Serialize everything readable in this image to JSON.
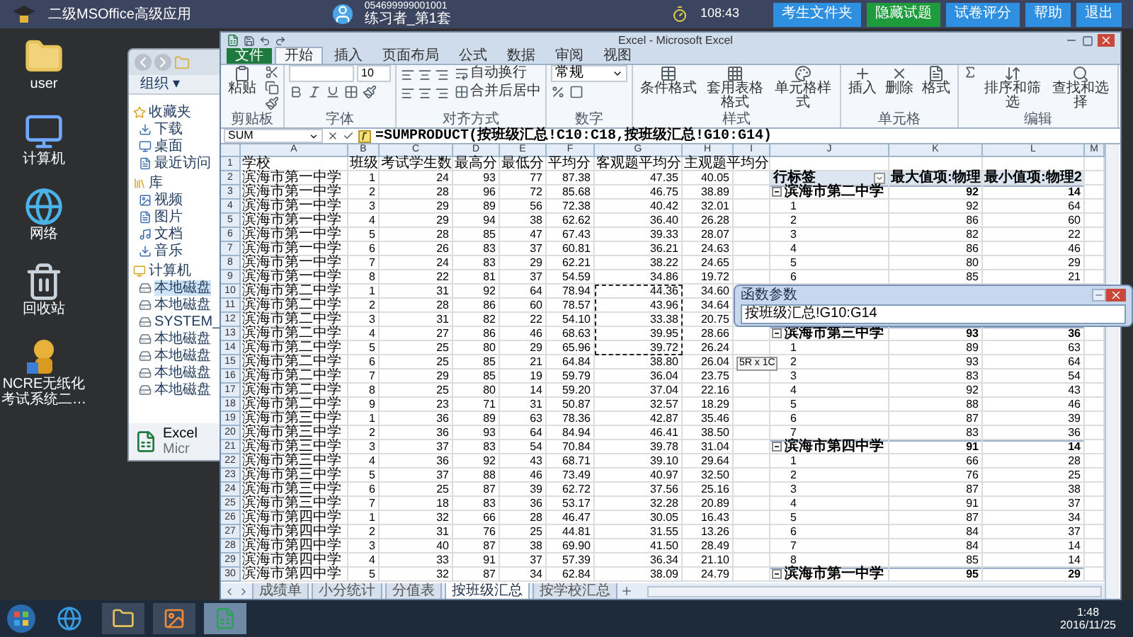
{
  "exam_bar": {
    "title": "二级MSOffice高级应用",
    "candidate_id": "054699999001001",
    "candidate_name": "练习者_第1套",
    "timer": "108:43",
    "buttons": [
      {
        "label": "考生文件夹",
        "color": "#2f8fe0"
      },
      {
        "label": "隐藏试题",
        "color": "#1e9b3c"
      },
      {
        "label": "试卷评分",
        "color": "#2f8fe0"
      },
      {
        "label": "帮助",
        "color": "#2f8fe0"
      },
      {
        "label": "退出",
        "color": "#2f8fe0"
      }
    ]
  },
  "desktop_icons": [
    {
      "kind": "folder",
      "label": "user"
    },
    {
      "kind": "computer",
      "label": "计算机"
    },
    {
      "kind": "network",
      "label": "网络"
    },
    {
      "kind": "trash",
      "label": "回收站"
    },
    {
      "kind": "app",
      "label": "NCRE无纸化考试系统二…"
    }
  ],
  "explorer": {
    "organize": "组织 ▾",
    "items": [
      {
        "kind": "section",
        "label": "收藏夹"
      },
      {
        "kind": "item",
        "label": "下载"
      },
      {
        "kind": "item",
        "label": "桌面"
      },
      {
        "kind": "item",
        "label": "最近访问"
      },
      {
        "kind": "section",
        "label": "库"
      },
      {
        "kind": "item",
        "label": "视频"
      },
      {
        "kind": "item",
        "label": "图片"
      },
      {
        "kind": "item",
        "label": "文档"
      },
      {
        "kind": "item",
        "label": "音乐"
      },
      {
        "kind": "section",
        "label": "计算机"
      },
      {
        "kind": "drive",
        "label": "本地磁盘",
        "selected": true
      },
      {
        "kind": "drive",
        "label": "本地磁盘",
        "selected": false
      },
      {
        "kind": "drive",
        "label": "SYSTEM_",
        "selected": false
      },
      {
        "kind": "drive",
        "label": "本地磁盘",
        "selected": false
      },
      {
        "kind": "drive",
        "label": "本地磁盘",
        "selected": false
      },
      {
        "kind": "drive",
        "label": "本地磁盘",
        "selected": false
      },
      {
        "kind": "drive",
        "label": "本地磁盘",
        "selected": false
      }
    ],
    "file": {
      "name": "Excel",
      "type": "Micr"
    }
  },
  "excel": {
    "title": "Excel - Microsoft Excel",
    "tabs": [
      {
        "label": "文件",
        "kind": "file",
        "selected": false
      },
      {
        "label": "开始",
        "kind": "tab",
        "selected": true
      },
      {
        "label": "插入",
        "kind": "tab",
        "selected": false
      },
      {
        "label": "页面布局",
        "kind": "tab",
        "selected": false
      },
      {
        "label": "公式",
        "kind": "tab",
        "selected": false
      },
      {
        "label": "数据",
        "kind": "tab",
        "selected": false
      },
      {
        "label": "审阅",
        "kind": "tab",
        "selected": false
      },
      {
        "label": "视图",
        "kind": "tab",
        "selected": false
      }
    ],
    "ribbon": [
      {
        "kind": "clipboard",
        "label": "剪贴板",
        "buttons": [
          "粘贴"
        ]
      },
      {
        "kind": "font",
        "label": "字体",
        "font_size": "10"
      },
      {
        "kind": "alignment",
        "label": "对齐方式",
        "buttons": [
          "自动换行",
          "合并后居中"
        ]
      },
      {
        "kind": "number",
        "label": "数字",
        "format": "常规"
      },
      {
        "kind": "styles",
        "label": "样式",
        "buttons": [
          "条件格式",
          "套用表格格式",
          "单元格样式"
        ]
      },
      {
        "kind": "cells",
        "label": "单元格",
        "buttons": [
          "插入",
          "删除",
          "格式"
        ]
      },
      {
        "kind": "editing",
        "label": "编辑",
        "buttons": [
          "排序和筛选",
          "查找和选择"
        ]
      }
    ],
    "name_box": "SUM",
    "formula": "=SUMPRODUCT(按班级汇总!C10:C18,按班级汇总!G10:G14)",
    "columns": [
      "A",
      "B",
      "C",
      "D",
      "E",
      "F",
      "G",
      "H",
      "I",
      "J",
      "K",
      "L",
      "M"
    ],
    "rows": [
      {
        "number": "1",
        "cells": [
          "学校",
          "班级",
          "考试学生数",
          "最高分",
          "最低分",
          "平均分",
          "客观题平均分",
          "主观题平均分"
        ]
      },
      {
        "number": "2",
        "cells": [
          "滨海市第一中学",
          "1",
          "24",
          "93",
          "77",
          "87.38",
          "47.35",
          "40.05"
        ],
        "pivot": {
          "kind": "header",
          "label": "行标签",
          "max": "最大值项:物理",
          "min": "最小值项:物理2"
        }
      },
      {
        "number": "3",
        "cells": [
          "滨海市第一中学",
          "2",
          "28",
          "96",
          "72",
          "85.68",
          "46.75",
          "38.89"
        ],
        "pivot": {
          "kind": "group",
          "label": "滨海市第二中学",
          "max": "92",
          "min": "14",
          "expanded": true
        }
      },
      {
        "number": "4",
        "cells": [
          "滨海市第一中学",
          "3",
          "29",
          "89",
          "56",
          "72.38",
          "40.42",
          "32.01"
        ],
        "pivot": {
          "kind": "item",
          "label": "1",
          "max": "92",
          "min": "64"
        }
      },
      {
        "number": "5",
        "cells": [
          "滨海市第一中学",
          "4",
          "29",
          "94",
          "38",
          "62.62",
          "36.40",
          "26.28"
        ],
        "pivot": {
          "kind": "item",
          "label": "2",
          "max": "86",
          "min": "60"
        }
      },
      {
        "number": "6",
        "cells": [
          "滨海市第一中学",
          "5",
          "28",
          "85",
          "47",
          "67.43",
          "39.33",
          "28.07"
        ],
        "pivot": {
          "kind": "item",
          "label": "3",
          "max": "82",
          "min": "22"
        }
      },
      {
        "number": "7",
        "cells": [
          "滨海市第一中学",
          "6",
          "26",
          "83",
          "37",
          "60.81",
          "36.21",
          "24.63"
        ],
        "pivot": {
          "kind": "item",
          "label": "4",
          "max": "86",
          "min": "46"
        }
      },
      {
        "number": "8",
        "cells": [
          "滨海市第一中学",
          "7",
          "24",
          "83",
          "29",
          "62.21",
          "38.22",
          "24.65"
        ],
        "pivot": {
          "kind": "item",
          "label": "5",
          "max": "80",
          "min": "29"
        }
      },
      {
        "number": "9",
        "cells": [
          "滨海市第一中学",
          "8",
          "22",
          "81",
          "37",
          "54.59",
          "34.86",
          "19.72"
        ],
        "pivot": {
          "kind": "item",
          "label": "6",
          "max": "85",
          "min": "21"
        }
      },
      {
        "number": "10",
        "cells": [
          "滨海市第二中学",
          "1",
          "31",
          "92",
          "64",
          "78.94",
          "44.36",
          "34.60"
        ]
      },
      {
        "number": "11",
        "cells": [
          "滨海市第二中学",
          "2",
          "28",
          "86",
          "60",
          "78.57",
          "43.96",
          "34.64"
        ]
      },
      {
        "number": "12",
        "cells": [
          "滨海市第二中学",
          "3",
          "31",
          "82",
          "22",
          "54.10",
          "33.38",
          "20.75"
        ]
      },
      {
        "number": "13",
        "cells": [
          "滨海市第二中学",
          "4",
          "27",
          "86",
          "46",
          "68.63",
          "39.95",
          "28.66"
        ],
        "pivot": {
          "kind": "group",
          "label": "滨海市第三中学",
          "max": "93",
          "min": "36",
          "expanded": true
        }
      },
      {
        "number": "14",
        "cells": [
          "滨海市第二中学",
          "5",
          "25",
          "80",
          "29",
          "65.96",
          "39.72",
          "26.24"
        ],
        "pivot": {
          "kind": "item",
          "label": "1",
          "max": "89",
          "min": "63"
        }
      },
      {
        "number": "15",
        "cells": [
          "滨海市第二中学",
          "6",
          "25",
          "85",
          "21",
          "64.84",
          "38.80",
          "26.04"
        ],
        "pivot": {
          "kind": "item",
          "label": "2",
          "max": "93",
          "min": "64"
        }
      },
      {
        "number": "16",
        "cells": [
          "滨海市第二中学",
          "7",
          "29",
          "85",
          "19",
          "59.79",
          "36.04",
          "23.75"
        ],
        "pivot": {
          "kind": "item",
          "label": "3",
          "max": "83",
          "min": "54"
        }
      },
      {
        "number": "17",
        "cells": [
          "滨海市第二中学",
          "8",
          "25",
          "80",
          "14",
          "59.20",
          "37.04",
          "22.16"
        ],
        "pivot": {
          "kind": "item",
          "label": "4",
          "max": "92",
          "min": "43"
        }
      },
      {
        "number": "18",
        "cells": [
          "滨海市第二中学",
          "9",
          "23",
          "71",
          "31",
          "50.87",
          "32.57",
          "18.29"
        ],
        "pivot": {
          "kind": "item",
          "label": "5",
          "max": "88",
          "min": "46"
        }
      },
      {
        "number": "19",
        "cells": [
          "滨海市第三中学",
          "1",
          "36",
          "89",
          "63",
          "78.36",
          "42.87",
          "35.46"
        ],
        "pivot": {
          "kind": "item",
          "label": "6",
          "max": "87",
          "min": "39"
        }
      },
      {
        "number": "20",
        "cells": [
          "滨海市第三中学",
          "2",
          "36",
          "93",
          "64",
          "84.94",
          "46.41",
          "38.50"
        ],
        "pivot": {
          "kind": "item",
          "label": "7",
          "max": "83",
          "min": "36"
        }
      },
      {
        "number": "21",
        "cells": [
          "滨海市第三中学",
          "3",
          "37",
          "83",
          "54",
          "70.84",
          "39.78",
          "31.04"
        ],
        "pivot": {
          "kind": "group",
          "label": "滨海市第四中学",
          "max": "91",
          "min": "14",
          "expanded": true
        }
      },
      {
        "number": "22",
        "cells": [
          "滨海市第三中学",
          "4",
          "36",
          "92",
          "43",
          "68.71",
          "39.10",
          "29.64"
        ],
        "pivot": {
          "kind": "item",
          "label": "1",
          "max": "66",
          "min": "28"
        }
      },
      {
        "number": "23",
        "cells": [
          "滨海市第三中学",
          "5",
          "37",
          "88",
          "46",
          "73.49",
          "40.97",
          "32.50"
        ],
        "pivot": {
          "kind": "item",
          "label": "2",
          "max": "76",
          "min": "25"
        }
      },
      {
        "number": "24",
        "cells": [
          "滨海市第三中学",
          "6",
          "25",
          "87",
          "39",
          "62.72",
          "37.56",
          "25.16"
        ],
        "pivot": {
          "kind": "item",
          "label": "3",
          "max": "87",
          "min": "38"
        }
      },
      {
        "number": "25",
        "cells": [
          "滨海市第三中学",
          "7",
          "18",
          "83",
          "36",
          "53.17",
          "32.28",
          "20.89"
        ],
        "pivot": {
          "kind": "item",
          "label": "4",
          "max": "91",
          "min": "37"
        }
      },
      {
        "number": "26",
        "cells": [
          "滨海市第四中学",
          "1",
          "32",
          "66",
          "28",
          "46.47",
          "30.05",
          "16.43"
        ],
        "pivot": {
          "kind": "item",
          "label": "5",
          "max": "87",
          "min": "34"
        }
      },
      {
        "number": "27",
        "cells": [
          "滨海市第四中学",
          "2",
          "31",
          "76",
          "25",
          "44.81",
          "31.55",
          "13.26"
        ],
        "pivot": {
          "kind": "item",
          "label": "6",
          "max": "84",
          "min": "37"
        }
      },
      {
        "number": "28",
        "cells": [
          "滨海市第四中学",
          "3",
          "40",
          "87",
          "38",
          "69.90",
          "41.50",
          "28.49"
        ],
        "pivot": {
          "kind": "item",
          "label": "7",
          "max": "84",
          "min": "14"
        }
      },
      {
        "number": "29",
        "cells": [
          "滨海市第四中学",
          "4",
          "33",
          "91",
          "37",
          "57.39",
          "36.34",
          "21.10"
        ],
        "pivot": {
          "kind": "item",
          "label": "8",
          "max": "85",
          "min": "14"
        }
      },
      {
        "number": "30",
        "cells": [
          "滨海市第四中学",
          "5",
          "32",
          "87",
          "34",
          "62.84",
          "38.09",
          "24.79"
        ],
        "pivot": {
          "kind": "group",
          "label": "滨海市第一中学",
          "max": "95",
          "min": "29",
          "expanded": true
        }
      }
    ],
    "range_tip": "5R x 1C",
    "sheet_tabs": [
      {
        "label": "成绩单",
        "selected": false
      },
      {
        "label": "小分统计",
        "selected": false
      },
      {
        "label": "分值表",
        "selected": false
      },
      {
        "label": "按班级汇总",
        "selected": true
      },
      {
        "label": "按学校汇总",
        "selected": false
      }
    ],
    "dialog": {
      "title": "函数参数",
      "value": "按班级汇总!G10:G14"
    }
  },
  "taskbar": {
    "time": "1:48",
    "date": "2016/11/25"
  }
}
